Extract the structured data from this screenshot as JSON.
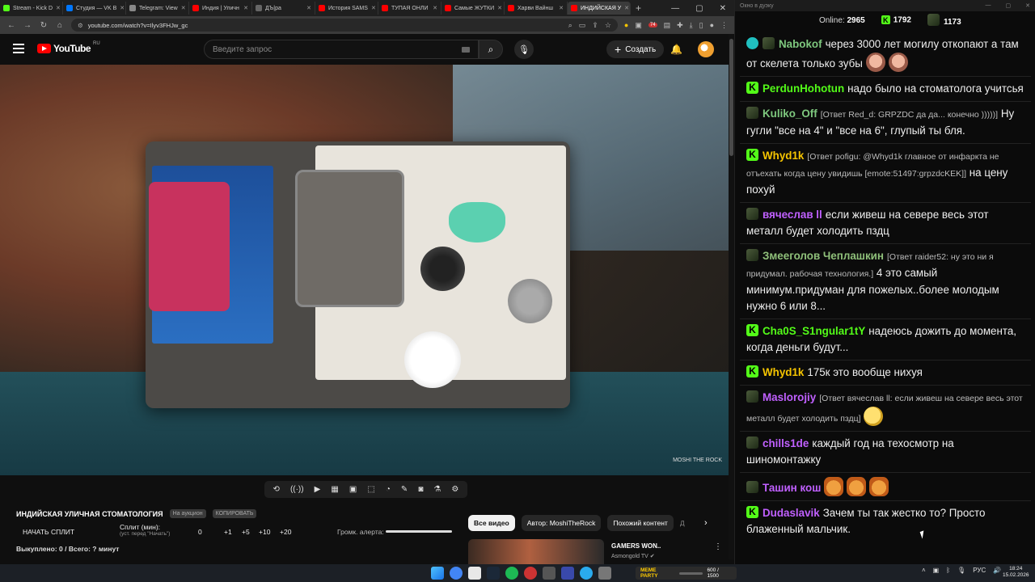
{
  "browser": {
    "tabs": [
      {
        "label": "Stream - Kick D",
        "color": "#53fc18"
      },
      {
        "label": "Студия — VK В",
        "color": "#0077ff"
      },
      {
        "label": "Telegram: View",
        "color": "#888888"
      },
      {
        "label": "Индия | Уличн",
        "color": "#ff0000"
      },
      {
        "label": "ДЪ|ра",
        "color": "#666666"
      },
      {
        "label": "История SAMS",
        "color": "#ff0000"
      },
      {
        "label": "ТУПАЯ ОНЛИ",
        "color": "#ff0000"
      },
      {
        "label": "Самые ЖУТКИ",
        "color": "#ff0000"
      },
      {
        "label": "Харви Вайнш",
        "color": "#ff0000"
      },
      {
        "label": "ИНДИЙСКАЯ У",
        "color": "#ff0000",
        "active": true
      }
    ],
    "url": "youtube.com/watch?v=Ilyv3FHJw_gc",
    "ext_badge": "74"
  },
  "youtube": {
    "logo_text": "YouTube",
    "region": "RU",
    "search_placeholder": "Введите запрос",
    "create_label": "Создать",
    "video_watermark": "MOSHI THE ROCK"
  },
  "stream_panel": {
    "title": "ИНДИЙСКАЯ УЛИЧНАЯ СТОМАТОЛОГИЯ",
    "chip_auction": "На аукцион",
    "chip_copy": "КОПИРОВАТЬ",
    "start_split": "НАЧАТЬ СПЛИТ",
    "split_label": "Сплит (мин):",
    "split_sub": "(уст. перед \"Начать\")",
    "split_values": [
      "0",
      "+1",
      "+5",
      "+10",
      "+20"
    ],
    "alert_volume": "Громк. алерта:",
    "alert_volume_level": 1.0,
    "bought": "Выкуплено: 0 / Всего: ? минут"
  },
  "recommendations": {
    "chips": [
      "Все видео",
      "Автор: MoshiTheRock",
      "Похожий контент",
      "Д"
    ],
    "video_title": "GAMERS WON..",
    "video_channel": "Asmongold TV"
  },
  "chat": {
    "window_title": "Окно в дуэку",
    "online_label": "Online:",
    "online_count": "2965",
    "kick_count": "1792",
    "sub_count": "1173",
    "messages": [
      {
        "badges": [
          "ver",
          "sub"
        ],
        "user": "Nabokof",
        "color": "#7ec87e",
        "text": "через 3000 лет могилу откопают а там от скелета только зубы",
        "emotes": [
          "face",
          "face"
        ]
      },
      {
        "badges": [
          "k"
        ],
        "user": "PerdunHohotun",
        "color": "#53fc18",
        "text": "надо было на стоматолога учитсья"
      },
      {
        "badges": [
          "sub"
        ],
        "user": "Kuliko_Off",
        "color": "#7ec87e",
        "reply": "[Ответ Red_d: GRPZDC да да... конечно )))))]",
        "text": "Ну гугли \"все на 4\" и \"все на 6\", глупый ты бля."
      },
      {
        "badges": [
          "k"
        ],
        "user": "Whyd1k",
        "color": "#f5c400",
        "reply": "[Ответ pofigu: @Whyd1k главное от инфаркта не отъехать когда цену увидишь [emote:51497:grpzdcKEK]]",
        "text": "на цену похуй"
      },
      {
        "badges": [
          "sub"
        ],
        "user": "вячеслав ll",
        "color": "#c060ff",
        "text": "если живеш на севере весь этот металл будет холодить пздц"
      },
      {
        "badges": [
          "sub"
        ],
        "user": "Змееголов Чеплашкин",
        "color": "#8fc07a",
        "reply": "[Ответ raider52: ну это ни я придумал. рабочая технология.]",
        "text": "4 это самый минимум.придуман для пожелых..более молодым нужно 6 или 8..."
      },
      {
        "badges": [
          "k"
        ],
        "user": "Cha0S_S1ngular1tY",
        "color": "#53fc18",
        "text": "надеюсь дожить до момента, когда деньги будут..."
      },
      {
        "badges": [
          "k"
        ],
        "user": "Whyd1k",
        "color": "#f5c400",
        "text": "175к это вообще нихуя"
      },
      {
        "badges": [
          "sub"
        ],
        "user": "Maslorojiy",
        "color": "#c060ff",
        "reply": "[Ответ вячеслав ll: если живеш на севере весь этот металл будет холодить пздц]",
        "text": "",
        "emotes": [
          "yellow"
        ]
      },
      {
        "badges": [
          "sub"
        ],
        "user": "chills1de",
        "color": "#c060ff",
        "text": "каждый год на техосмотр на шиномонтажку"
      },
      {
        "badges": [
          "sub"
        ],
        "user": "Ташин кош",
        "color": "#c060ff",
        "text": "",
        "emotes": [
          "cat",
          "cat",
          "cat"
        ]
      },
      {
        "badges": [
          "k"
        ],
        "user": "Dudaslavik",
        "color": "#c060ff",
        "text": "Зачем ты так жестко то? Просто блаженный мальчик."
      }
    ]
  },
  "taskbar": {
    "media_label": "MEME PARTY",
    "media_progress": "600 / 1500",
    "lang": "РУС",
    "time": "18:24",
    "date": "15.02.2026"
  }
}
